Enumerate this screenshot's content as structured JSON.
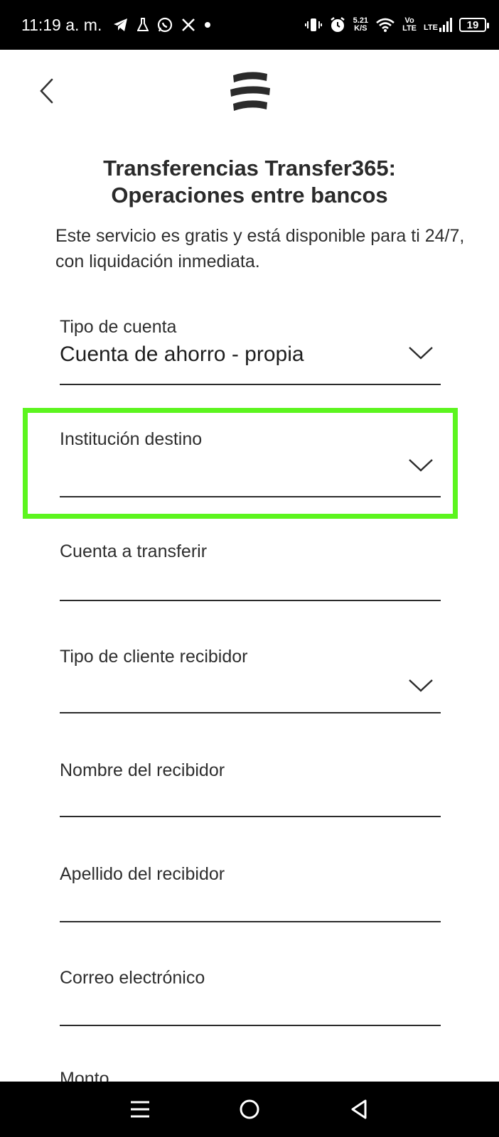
{
  "status_bar": {
    "time": "11:19 a. m.",
    "net_speed_value": "5.21",
    "net_speed_unit": "K/S",
    "volte_top": "Vo",
    "volte_bottom": "LTE",
    "lte_label": "LTE",
    "battery": "19"
  },
  "header": {
    "title_line1": "Transferencias Transfer365:",
    "title_line2": "Operaciones entre bancos",
    "description": "Este servicio es gratis y está disponible para ti 24/7, con liquidación inmediata."
  },
  "form": {
    "account_type": {
      "label": "Tipo de cuenta",
      "value": "Cuenta de ahorro - propia"
    },
    "destination_institution": {
      "label": "Institución destino",
      "value": ""
    },
    "transfer_account": {
      "label": "Cuenta a transferir",
      "value": ""
    },
    "recipient_client_type": {
      "label": "Tipo de cliente recibidor",
      "value": ""
    },
    "recipient_name": {
      "label": "Nombre del recibidor",
      "value": ""
    },
    "recipient_lastname": {
      "label": "Apellido del recibidor",
      "value": ""
    },
    "email": {
      "label": "Correo electrónico",
      "value": ""
    },
    "amount": {
      "label": "Monto"
    }
  },
  "colors": {
    "highlight": "#5cf51e",
    "text": "#2e2e2e",
    "status_bar_bg": "#000000"
  }
}
